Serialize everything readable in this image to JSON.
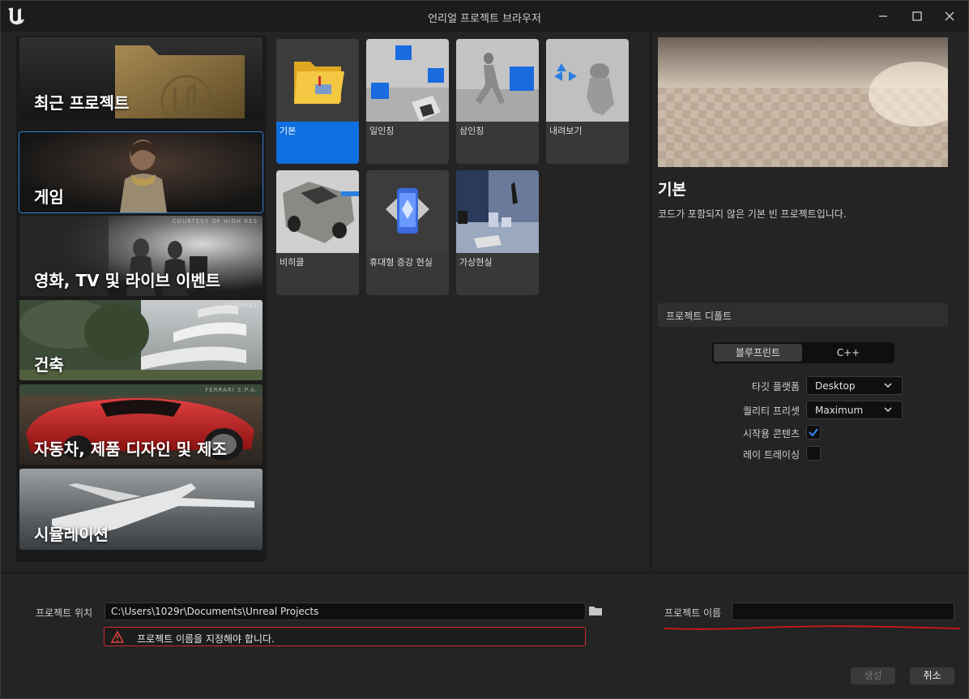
{
  "window": {
    "title": "언리얼 프로젝트 브라우저"
  },
  "categories": [
    {
      "label": "최근 프로젝트",
      "credit": ""
    },
    {
      "label": "게임",
      "credit": ""
    },
    {
      "label": "영화, TV 및 라이브 이벤트",
      "credit": "COURTESY OF HIGH RES"
    },
    {
      "label": "건축",
      "credit": "TILTPIXEL"
    },
    {
      "label": "자동차, 제품 디자인 및 제조",
      "credit": "FERRARI S.P.A."
    },
    {
      "label": "시뮬레이션",
      "credit": ""
    }
  ],
  "selected_category": "게임",
  "templates": [
    {
      "label": "기본"
    },
    {
      "label": "일인칭"
    },
    {
      "label": "삼인칭"
    },
    {
      "label": "내려보기"
    },
    {
      "label": "비히클"
    },
    {
      "label": "휴대형 증강 현실"
    },
    {
      "label": "가상현실"
    }
  ],
  "selected_template": "기본",
  "details": {
    "title": "기본",
    "description": "코드가 포함되지 않은 기본 빈 프로젝트입니다."
  },
  "project_defaults": {
    "header": "프로젝트 디폴트",
    "blueprint_label": "블루프린트",
    "cpp_label": "C++",
    "selected_language": "블루프린트",
    "target_platform_label": "타깃 플랫폼",
    "target_platform_value": "Desktop",
    "quality_preset_label": "퀄리티 프리셋",
    "quality_preset_value": "Maximum",
    "starter_content_label": "시작용 콘텐츠",
    "starter_content_checked": true,
    "ray_tracing_label": "레이 트레이싱",
    "ray_tracing_checked": false
  },
  "bottom": {
    "location_label": "프로젝트 위치",
    "location_value": "C:\\Users\\1029r\\Documents\\Unreal Projects",
    "error_text": "프로젝트 이름을 지정해야 합니다.",
    "name_label": "프로젝트 이름",
    "name_value": "",
    "create_label": "생성",
    "cancel_label": "취소"
  },
  "colors": {
    "accent_blue": "#0e6fe0",
    "error_red": "#d02b2b"
  }
}
